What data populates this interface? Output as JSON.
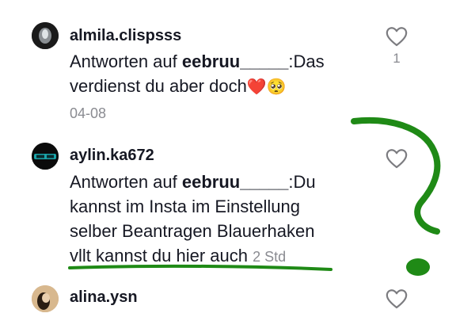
{
  "comments": [
    {
      "username": "almila.clispsss",
      "reply_prefix": "Antworten auf ",
      "reply_to": "eebruu_____",
      "text_line1": ":Das",
      "text_line2": "verdienst du aber doch",
      "emojis": "❤️🥺",
      "date": "04-08",
      "like_count": "1",
      "icons": {
        "like": "heart-outline-icon"
      }
    },
    {
      "username": "aylin.ka672",
      "reply_prefix": "Antworten auf ",
      "reply_to": "eebruu_____",
      "text_line1": ":Du",
      "text_line2": "kannst im Insta im Einstellung",
      "text_line3": "selber Beantragen Blauerhaken",
      "text_line4": "vllt kannst du hier auch",
      "date": "2 Std",
      "icons": {
        "like": "heart-outline-icon"
      }
    },
    {
      "username": "alina.ysn",
      "icons": {
        "like": "heart-outline-icon"
      }
    }
  ],
  "annotation": {
    "color": "#1f8a16",
    "marks": [
      "question-mark",
      "underline"
    ]
  }
}
